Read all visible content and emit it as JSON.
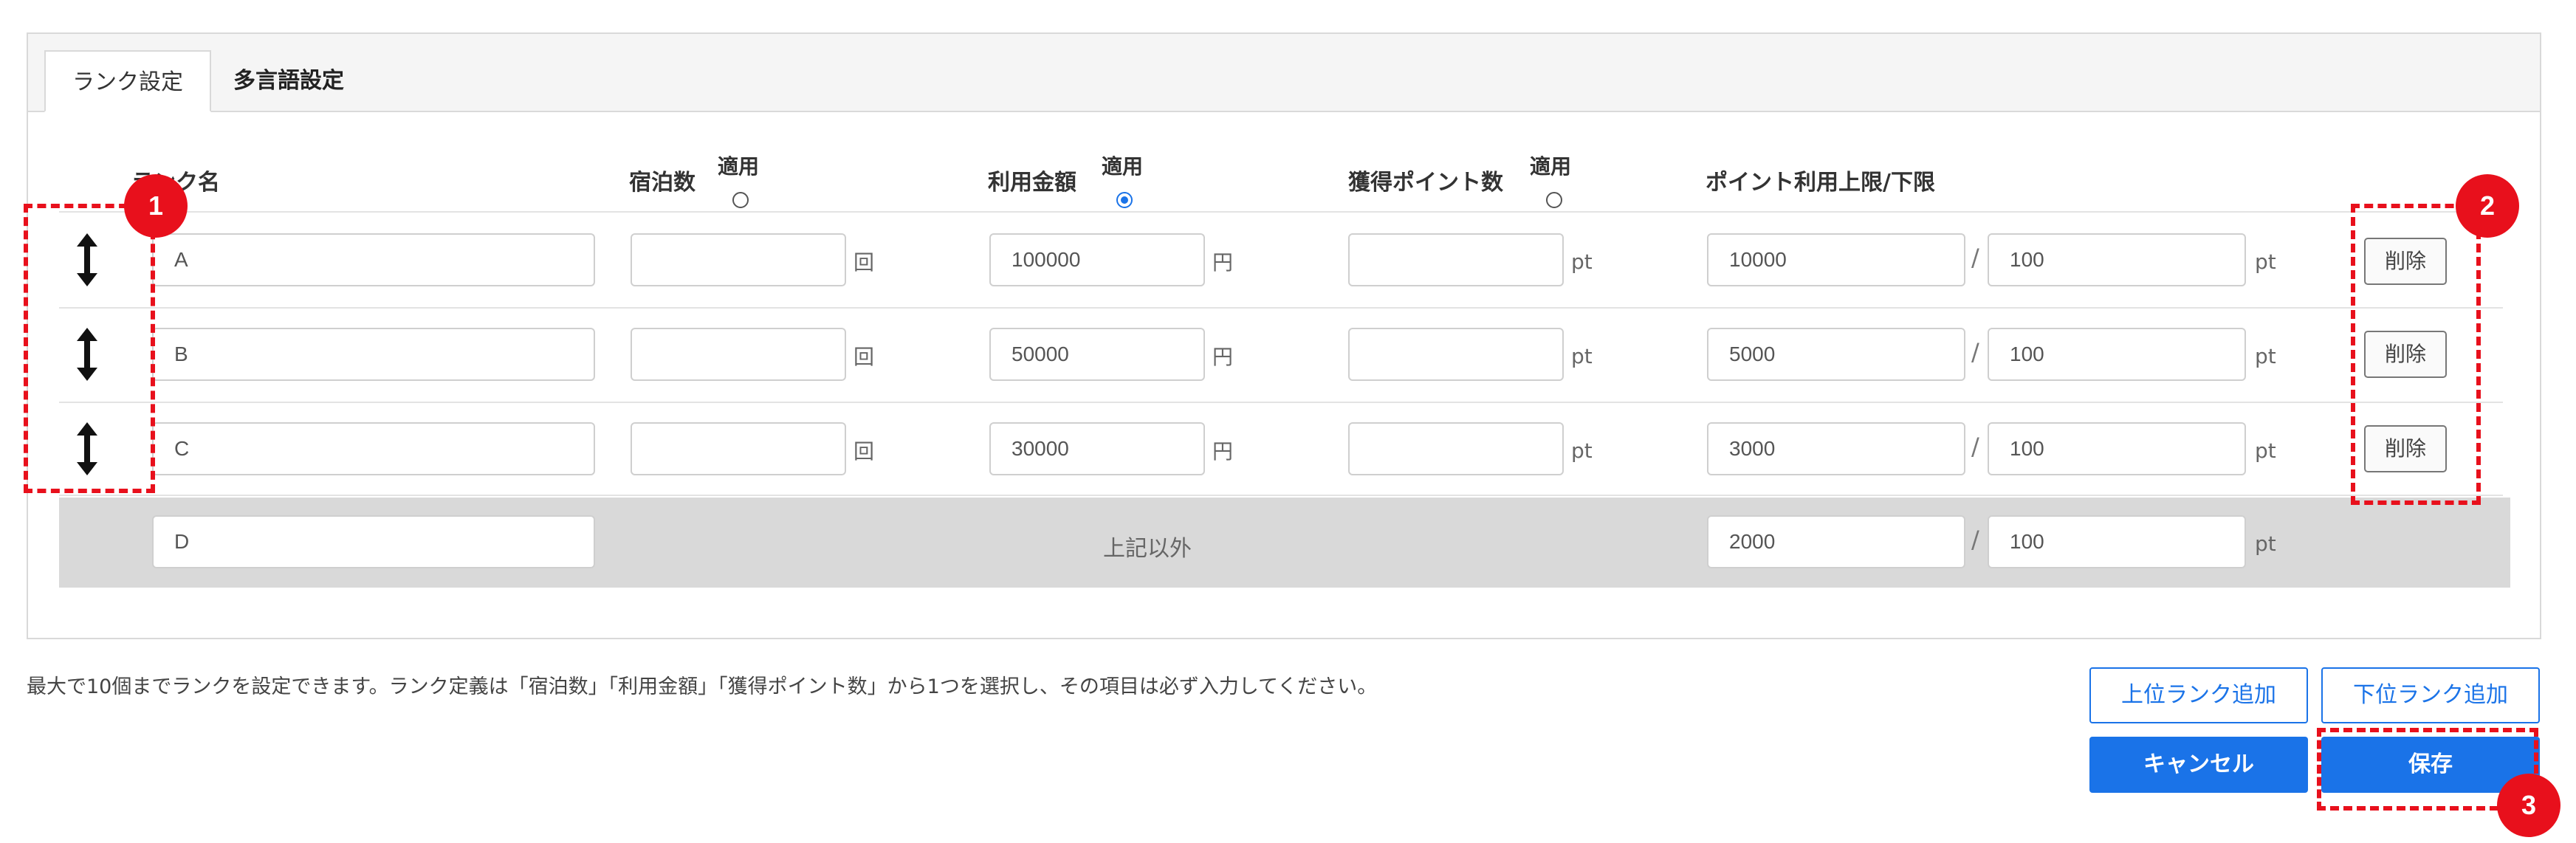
{
  "tabs": {
    "rank_settings": "ランク設定",
    "multilingual": "多言語設定"
  },
  "headers": {
    "rank_name": "ランク名",
    "stays": "宿泊数",
    "amount": "利用金額",
    "points": "獲得ポイント数",
    "point_limit": "ポイント利用上限/下限",
    "apply": "適用"
  },
  "apply_selected": "amount",
  "units": {
    "stays": "回",
    "amount": "円",
    "pt": "pt"
  },
  "rows": [
    {
      "name": "A",
      "stays": "",
      "amount": "100000",
      "points": "",
      "limit_upper": "10000",
      "limit_lower": "100",
      "delete": "削除"
    },
    {
      "name": "B",
      "stays": "",
      "amount": "50000",
      "points": "",
      "limit_upper": "5000",
      "limit_lower": "100",
      "delete": "削除"
    },
    {
      "name": "C",
      "stays": "",
      "amount": "30000",
      "points": "",
      "limit_upper": "3000",
      "limit_lower": "100",
      "delete": "削除"
    }
  ],
  "default_row": {
    "name": "D",
    "label": "上記以外",
    "limit_upper": "2000",
    "limit_lower": "100"
  },
  "separator": "/",
  "note": "最大で10個までランクを設定できます。ランク定義は「宿泊数」「利用金額」「獲得ポイント数」から1つを選択し、その項目は必ず入力してください。",
  "buttons": {
    "add_upper": "上位ランク追加",
    "add_lower": "下位ランク追加",
    "cancel": "キャンセル",
    "save": "保存"
  },
  "callouts": [
    "1",
    "2",
    "3"
  ],
  "colors": {
    "primary": "#1a73e8",
    "callout": "#e8101c",
    "gray_row": "#d9d9d9"
  }
}
